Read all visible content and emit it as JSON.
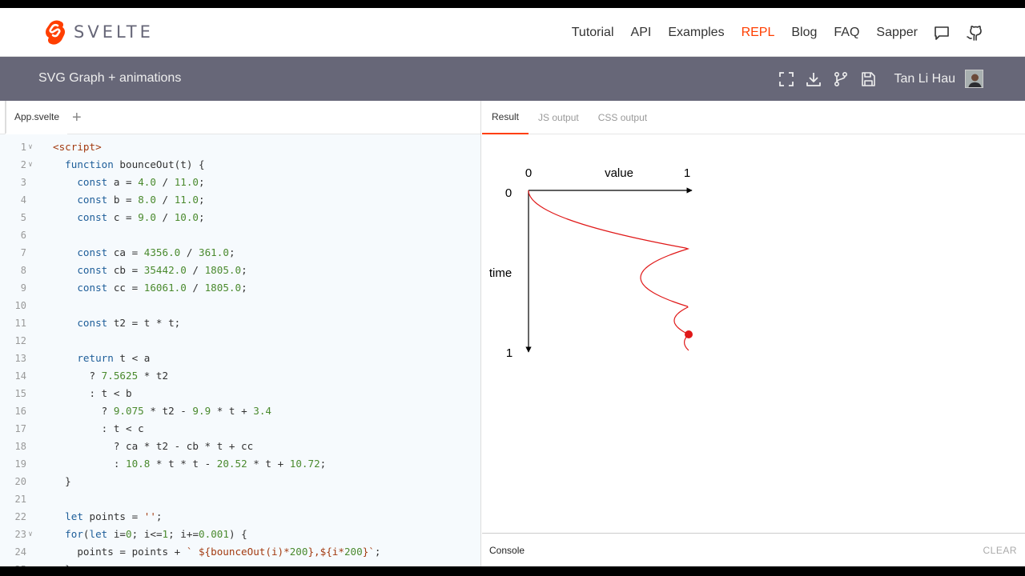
{
  "nav": {
    "brand": "SVELTE",
    "links": [
      {
        "label": "Tutorial",
        "active": false
      },
      {
        "label": "API",
        "active": false
      },
      {
        "label": "Examples",
        "active": false
      },
      {
        "label": "REPL",
        "active": true
      },
      {
        "label": "Blog",
        "active": false
      },
      {
        "label": "FAQ",
        "active": false
      },
      {
        "label": "Sapper",
        "active": false
      }
    ]
  },
  "app": {
    "title": "SVG Graph + animations",
    "user": "Tan Li Hau"
  },
  "editor": {
    "file_tab": "App.svelte",
    "add_tab": "+"
  },
  "code_lines": [
    "<script>",
    "  function bounceOut(t) {",
    "    const a = 4.0 / 11.0;",
    "    const b = 8.0 / 11.0;",
    "    const c = 9.0 / 10.0;",
    "",
    "    const ca = 4356.0 / 361.0;",
    "    const cb = 35442.0 / 1805.0;",
    "    const cc = 16061.0 / 1805.0;",
    "",
    "    const t2 = t * t;",
    "",
    "    return t < a",
    "      ? 7.5625 * t2",
    "      : t < b",
    "        ? 9.075 * t2 - 9.9 * t + 3.4",
    "        : t < c",
    "          ? ca * t2 - cb * t + cc",
    "          : 10.8 * t * t - 20.52 * t + 10.72;",
    "  }",
    "",
    "  let points = '';",
    "  for(let i=0; i<=1; i+=0.001) {",
    "    points = points + ` ${bounceOut(i)*200},${i*200}`;",
    "  }"
  ],
  "fold_lines": [
    1,
    2,
    23
  ],
  "result": {
    "tabs": [
      {
        "label": "Result",
        "active": true
      },
      {
        "label": "JS output",
        "active": false
      },
      {
        "label": "CSS output",
        "active": false
      }
    ],
    "console_label": "Console",
    "clear_label": "CLEAR"
  },
  "graph": {
    "value_axis_label": "value",
    "time_axis_label": "time",
    "value_start": "0",
    "value_end": "1",
    "time_start": "0",
    "time_end": "1",
    "curve_color": "#e01818",
    "dot_progress": 0.9
  },
  "colors": {
    "accent": "#ff3e00",
    "header_bg": "#676778"
  }
}
